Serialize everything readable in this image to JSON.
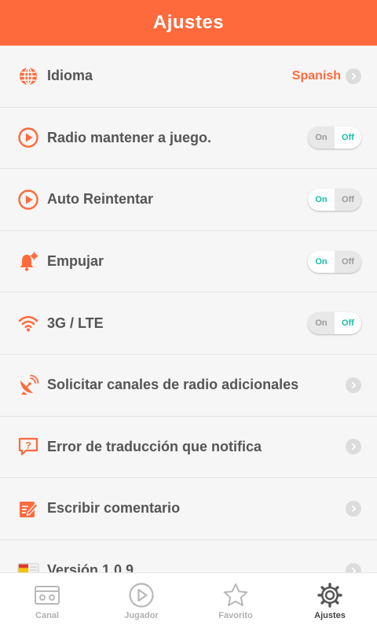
{
  "header": {
    "title": "Ajustes"
  },
  "settings": {
    "language": {
      "label": "Idioma",
      "value": "Spanish"
    },
    "radio_keep_playing": {
      "label": "Radio mantener a juego.",
      "on": "On",
      "off": "Off",
      "state": "off"
    },
    "auto_retry": {
      "label": "Auto Reintentar",
      "on": "On",
      "off": "Off",
      "state": "on"
    },
    "push": {
      "label": "Empujar",
      "on": "On",
      "off": "Off",
      "state": "on"
    },
    "mobile_data": {
      "label": "3G / LTE",
      "on": "On",
      "off": "Off",
      "state": "off"
    },
    "request_channels": {
      "label": "Solicitar canales de radio adicionales"
    },
    "report_translation": {
      "label": "Error de traducción que notifica"
    },
    "write_comment": {
      "label": "Escribir comentario"
    },
    "version": {
      "label": "Versión 1.0.9"
    }
  },
  "tabs": [
    {
      "label": "Canal",
      "icon": "radio-icon",
      "active": false
    },
    {
      "label": "Jugador",
      "icon": "play-circle-icon",
      "active": false
    },
    {
      "label": "Favorito",
      "icon": "star-icon",
      "active": false
    },
    {
      "label": "Ajustes",
      "icon": "gear-icon",
      "active": true
    }
  ],
  "colors": {
    "accent": "#ff6a3d",
    "toggle_active": "#17c1a4",
    "text": "#555555"
  }
}
